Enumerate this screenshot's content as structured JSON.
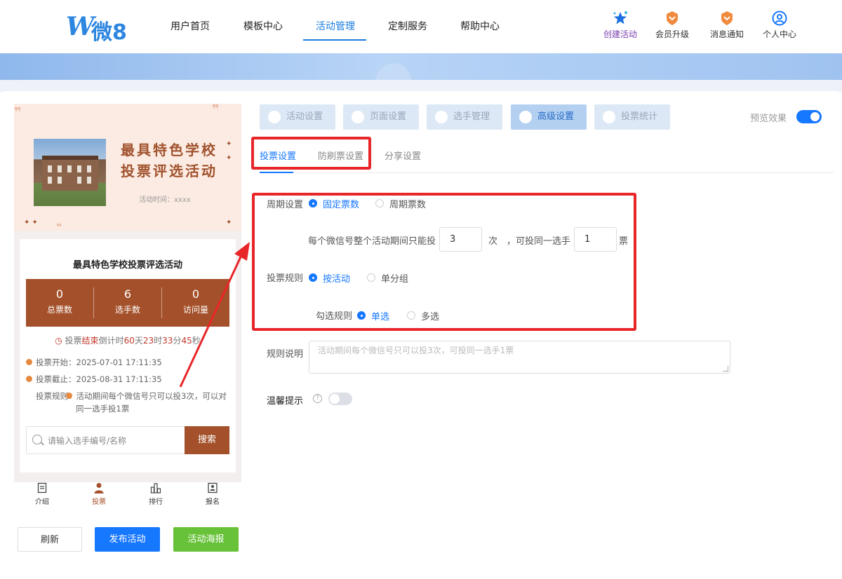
{
  "header": {
    "logo_text": "微8",
    "nav": [
      "用户首页",
      "模板中心",
      "活动管理",
      "定制服务",
      "帮助中心"
    ],
    "active_nav": "活动管理",
    "actions": [
      {
        "label": "创建活动",
        "icon": "star-icon",
        "color": "#7b3fb0"
      },
      {
        "label": "会员升级",
        "icon": "vip-badge-icon",
        "color": "#f08a3e"
      },
      {
        "label": "消息通知",
        "icon": "message-badge-icon",
        "color": "#f08a3e"
      },
      {
        "label": "个人中心",
        "icon": "user-circle-icon",
        "color": "#1677ff"
      }
    ]
  },
  "preview": {
    "poster_title_line1": "最具特色学校",
    "poster_title_line2": "投票评选活动",
    "poster_time": "活动时间：xxxx",
    "activity_title": "最具特色学校投票评选活动",
    "stats": [
      {
        "value": "0",
        "label": "总票数"
      },
      {
        "value": "6",
        "label": "选手数"
      },
      {
        "value": "0",
        "label": "访问量"
      }
    ],
    "countdown": {
      "prefix": "投票",
      "status": "结束",
      "text": "倒计时",
      "days": "60",
      "d_unit": "天",
      "hours": "23",
      "h_unit": "时",
      "mins": "33",
      "m_unit": "分",
      "secs": "45",
      "s_unit": "秒"
    },
    "info": [
      "投票开始：2025-07-01 17:11:35",
      "投票截止：2025-08-31 17:11:35",
      "投票规则：活动期间每个微信号只可以投3次，可以对同一选手投1票"
    ],
    "search_placeholder": "请输入选手编号/名称",
    "search_button": "搜索",
    "tabbar": [
      "介绍",
      "投票",
      "排行",
      "报名"
    ],
    "active_tab": "投票"
  },
  "buttons": {
    "refresh": "刷新",
    "publish": "发布活动",
    "poster": "活动海报"
  },
  "steps": [
    "活动设置",
    "页面设置",
    "选手管理",
    "高级设置",
    "投票统计"
  ],
  "active_step": "高级设置",
  "preview_toggle_label": "预览效果",
  "preview_toggle_on": true,
  "subtabs": [
    "投票设置",
    "防刷票设置",
    "分享设置"
  ],
  "active_subtab": "投票设置",
  "form": {
    "period_label": "周期设置",
    "period_options": [
      "固定票数",
      "周期票数"
    ],
    "period_selected": "固定票数",
    "limit_text_1": "每个微信号整个活动期间只能投",
    "limit_value": "3",
    "limit_text_2": "次",
    "limit_text_3": "，可投同一选手",
    "same_value": "1",
    "limit_text_4": "票",
    "rule_label": "投票规则",
    "rule_options": [
      "按活动",
      "单分组"
    ],
    "rule_selected": "按活动",
    "check_label": "勾选规则",
    "check_options": [
      "单选",
      "多选"
    ],
    "check_selected": "单选",
    "desc_label": "规则说明",
    "desc_placeholder": "活动期间每个微信号只可以投3次，可投同一选手1票",
    "tips_label": "温馨提示",
    "tips_on": false
  },
  "colors": {
    "accent": "#1677ff",
    "brand_brown": "#a4512b",
    "highlight_red": "#e8262a",
    "green": "#67c23a"
  }
}
